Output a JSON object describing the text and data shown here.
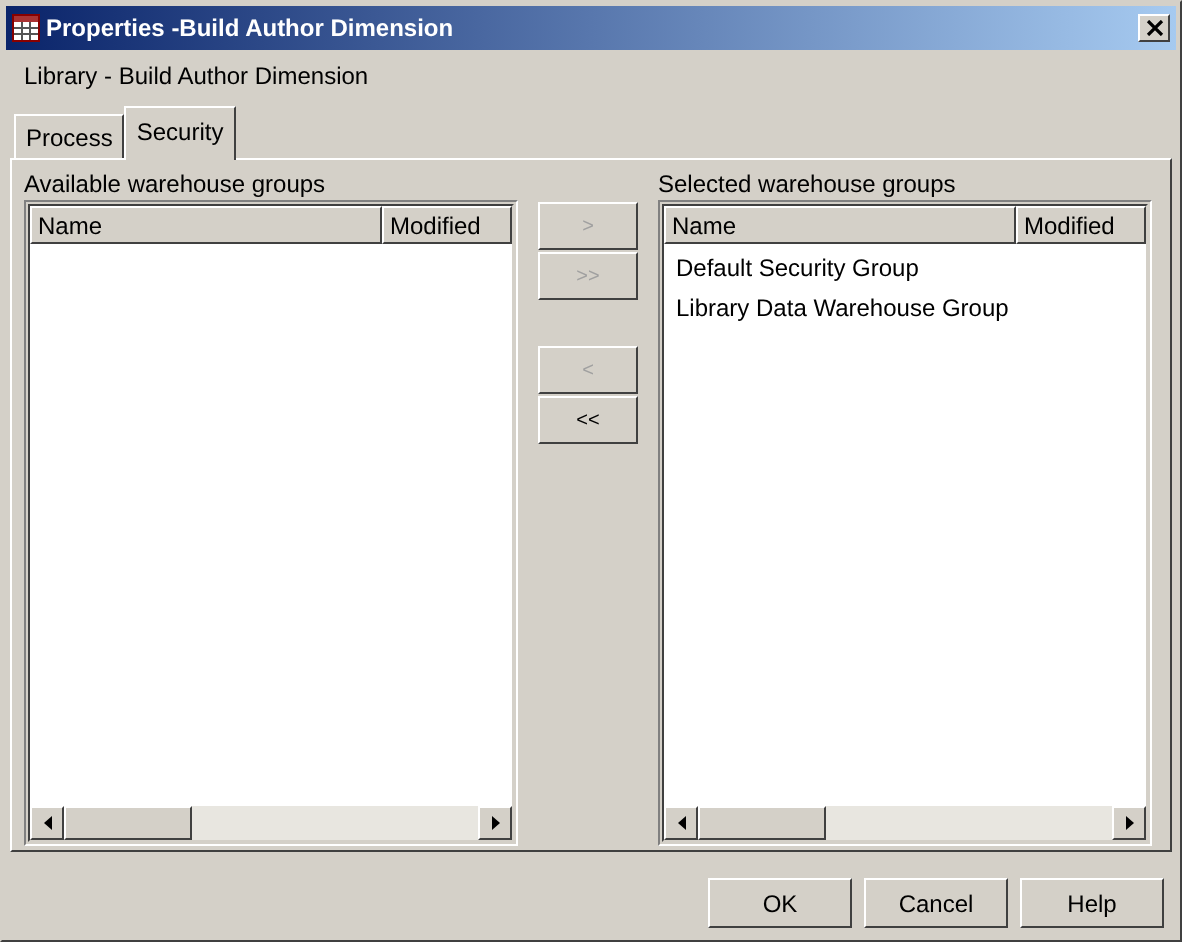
{
  "window": {
    "title": "Properties -Build Author Dimension"
  },
  "subtitle": "Library - Build Author Dimension",
  "tabs": [
    {
      "label": "Process",
      "selected": false
    },
    {
      "label": "Security",
      "selected": true
    }
  ],
  "available": {
    "label": "Available warehouse groups",
    "columns": [
      "Name",
      "Modified"
    ]
  },
  "transfer_buttons": [
    {
      "label": ">",
      "disabled": true
    },
    {
      "label": ">>",
      "disabled": true
    },
    {
      "label": "<",
      "disabled": true
    },
    {
      "label": "<<",
      "disabled": false
    }
  ],
  "selected_groups": {
    "label": "Selected warehouse groups",
    "columns": [
      "Name",
      "Modified"
    ],
    "rows": [
      "Default Security Group",
      "Library Data Warehouse Group"
    ]
  },
  "buttons": [
    "OK",
    "Cancel",
    "Help"
  ]
}
